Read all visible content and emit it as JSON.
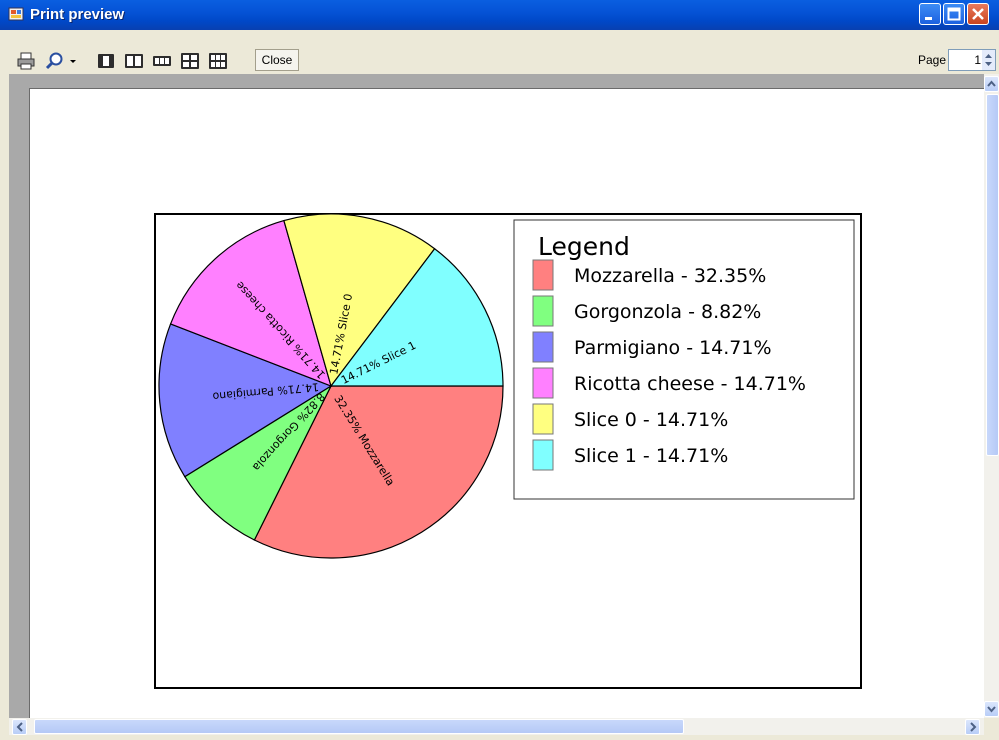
{
  "window": {
    "title": "Print preview"
  },
  "toolbar": {
    "close_label": "Close",
    "page_label": "Page",
    "page_value": "1",
    "icons": [
      "printer-icon",
      "zoom-icon",
      "one-page-icon",
      "two-pages-icon",
      "three-pages-icon",
      "four-pages-icon",
      "six-pages-icon"
    ]
  },
  "chart_data": {
    "type": "pie",
    "legend_title": "Legend",
    "legend_placement": "right",
    "slices": [
      {
        "name": "Mozzarella",
        "value": 32.35,
        "label": "32.35% Mozzarella",
        "legend": "Mozzarella - 32.35%",
        "color": "#ff8080"
      },
      {
        "name": "Gorgonzola",
        "value": 8.82,
        "label": "8.82% Gorgonzola",
        "legend": "Gorgonzola - 8.82%",
        "color": "#80ff80"
      },
      {
        "name": "Parmigiano",
        "value": 14.71,
        "label": "14.71% Parmigiano",
        "legend": "Parmigiano - 14.71%",
        "color": "#8080ff"
      },
      {
        "name": "Ricotta cheese",
        "value": 14.71,
        "label": "14.71% Ricotta cheese",
        "legend": "Ricotta cheese - 14.71%",
        "color": "#ff80ff"
      },
      {
        "name": "Slice 0",
        "value": 14.71,
        "label": "14.71% Slice 0",
        "legend": "Slice 0 - 14.71%",
        "color": "#ffff80"
      },
      {
        "name": "Slice 1",
        "value": 14.71,
        "label": "14.71% Slice 1",
        "legend": "Slice 1 - 14.71%",
        "color": "#80ffff"
      }
    ]
  }
}
